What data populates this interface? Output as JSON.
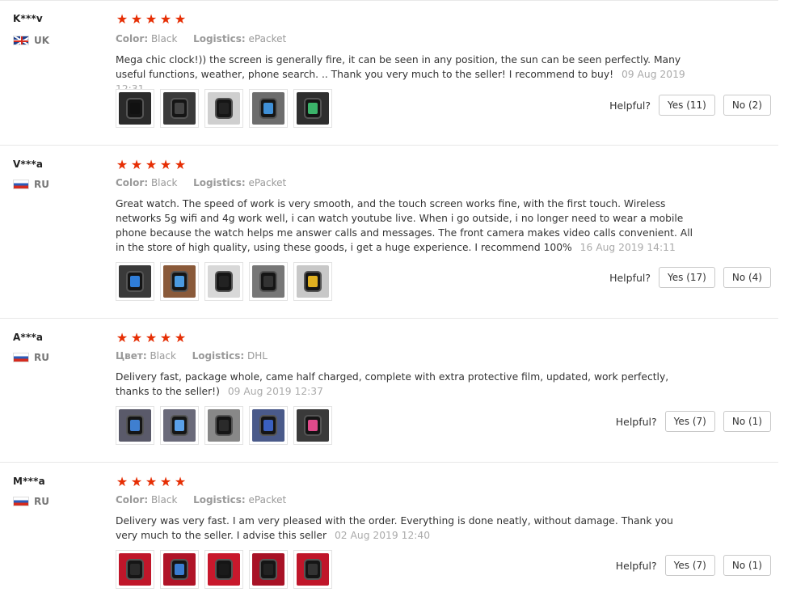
{
  "reviews": [
    {
      "user": "K***v",
      "country_flag": "uk",
      "country_code": "UK",
      "stars": 5,
      "color_key": "Color:",
      "color_val": "Black",
      "logistics_key": "Logistics:",
      "logistics_val": "ePacket",
      "text": "Mega chic clock!)) the screen is generally fire, it can be seen in any position, the sun can be seen perfectly. Many useful functions, weather, phone search. .. Thank you very much to the seller! I recommend to buy!",
      "date": "09 Aug 2019 12:31",
      "helpful_label": "Helpful?",
      "yes_label": "Yes (11)",
      "no_label": "No (2)"
    },
    {
      "user": "V***a",
      "country_flag": "ru",
      "country_code": "RU",
      "stars": 5,
      "color_key": "Color:",
      "color_val": "Black",
      "logistics_key": "Logistics:",
      "logistics_val": "ePacket",
      "text": "Great watch. The speed of work is very smooth, and the touch screen works fine, with the first touch. Wireless networks 5g wifi and 4g work well, i can watch youtube live. When i go outside, i no longer need to wear a mobile phone because the watch helps me answer calls and messages. The front camera makes video calls convenient. All in the store of high quality, using these goods, i get a huge experience. I recommend 100%",
      "date": "16 Aug 2019 14:11",
      "helpful_label": "Helpful?",
      "yes_label": "Yes (17)",
      "no_label": "No (4)"
    },
    {
      "user": "A***a",
      "country_flag": "ru",
      "country_code": "RU",
      "stars": 5,
      "color_key": "Цвет:",
      "color_val": "Black",
      "logistics_key": "Logistics:",
      "logistics_val": "DHL",
      "text": "Delivery fast, package whole, came half charged, complete with extra protective film, updated, work perfectly, thanks to the seller!)",
      "date": "09 Aug 2019 12:37",
      "helpful_label": "Helpful?",
      "yes_label": "Yes (7)",
      "no_label": "No (1)"
    },
    {
      "user": "M***a",
      "country_flag": "ru",
      "country_code": "RU",
      "stars": 5,
      "color_key": "Color:",
      "color_val": "Black",
      "logistics_key": "Logistics:",
      "logistics_val": "ePacket",
      "text": "Delivery was very fast. I am very pleased with the order. Everything is done neatly, without damage. Thank you very much to the seller. I advise this seller",
      "date": "02 Aug 2019 12:40",
      "helpful_label": "Helpful?",
      "yes_label": "Yes (7)",
      "no_label": "No (1)"
    }
  ],
  "colors": {
    "star": "#e62e04",
    "muted": "#999999",
    "divider": "#e8e8e8"
  }
}
